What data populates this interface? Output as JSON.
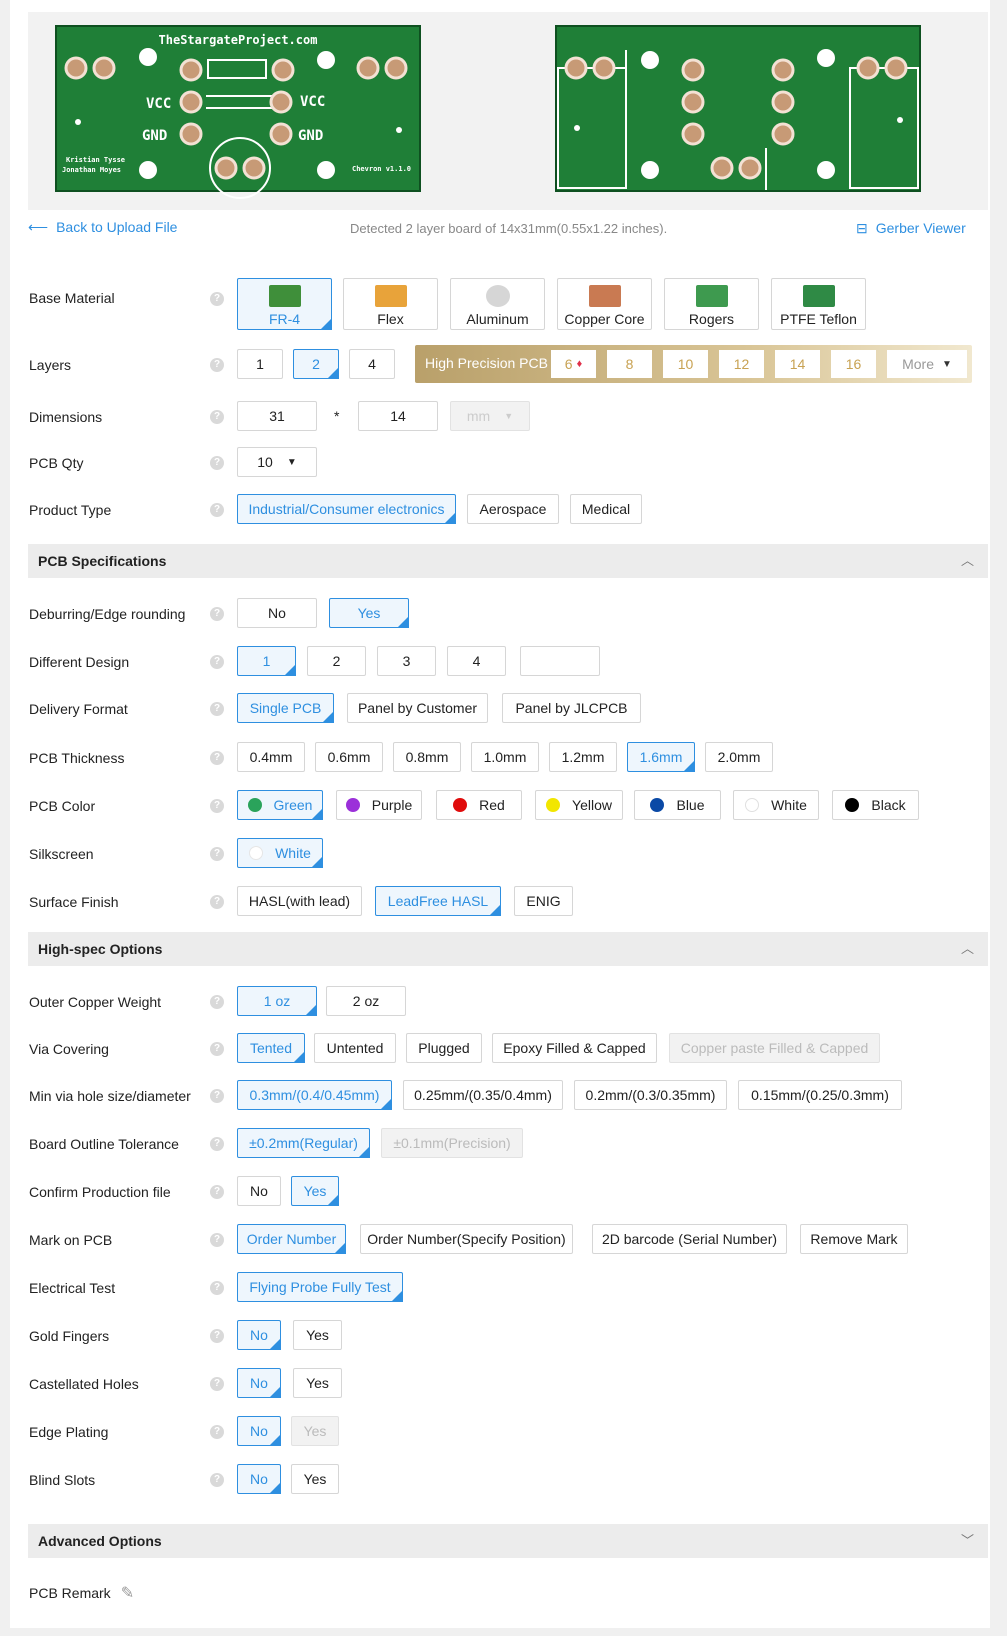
{
  "preview": {
    "top_text": "TheStargateProject.com",
    "vcc": "VCC",
    "gnd": "GND",
    "authors_line1": "Kristian Tysse",
    "authors_line2": "Jonathan Moyes",
    "version": "Chevron v1.1.0"
  },
  "nav": {
    "back": "Back to Upload File",
    "detected": "Detected 2 layer board of 14x31mm(0.55x1.22 inches).",
    "gerber": "Gerber Viewer"
  },
  "base_material": {
    "label": "Base Material",
    "options": [
      "FR-4",
      "Flex",
      "Aluminum",
      "Copper Core",
      "Rogers",
      "PTFE Teflon"
    ],
    "selected": "FR-4"
  },
  "layers": {
    "label": "Layers",
    "options": [
      "1",
      "2",
      "4"
    ],
    "selected": "2",
    "hp_label": "High Precision PCB",
    "hp_options": [
      "6",
      "8",
      "10",
      "12",
      "14",
      "16"
    ],
    "more": "More"
  },
  "dimensions": {
    "label": "Dimensions",
    "x": "31",
    "sep": "*",
    "y": "14",
    "unit": "mm"
  },
  "qty": {
    "label": "PCB Qty",
    "value": "10"
  },
  "product_type": {
    "label": "Product Type",
    "options": [
      "Industrial/Consumer electronics",
      "Aerospace",
      "Medical"
    ],
    "selected": "Industrial/Consumer electronics"
  },
  "pcb_spec": {
    "title": "PCB Specifications",
    "deburring": {
      "label": "Deburring/Edge rounding",
      "options": [
        "No",
        "Yes"
      ],
      "selected": "Yes"
    },
    "design": {
      "label": "Different Design",
      "options": [
        "1",
        "2",
        "3",
        "4",
        ""
      ],
      "selected": "1"
    },
    "delivery": {
      "label": "Delivery Format",
      "options": [
        "Single PCB",
        "Panel by Customer",
        "Panel by JLCPCB"
      ],
      "selected": "Single PCB"
    },
    "thickness": {
      "label": "PCB Thickness",
      "options": [
        "0.4mm",
        "0.6mm",
        "0.8mm",
        "1.0mm",
        "1.2mm",
        "1.6mm",
        "2.0mm"
      ],
      "selected": "1.6mm"
    },
    "color": {
      "label": "PCB Color",
      "options": [
        {
          "name": "Green",
          "hex": "#2aa35b"
        },
        {
          "name": "Purple",
          "hex": "#9b30d9"
        },
        {
          "name": "Red",
          "hex": "#e00c0c"
        },
        {
          "name": "Yellow",
          "hex": "#f2e600"
        },
        {
          "name": "Blue",
          "hex": "#0a49a6"
        },
        {
          "name": "White",
          "hex": "#ffffff"
        },
        {
          "name": "Black",
          "hex": "#000000"
        }
      ],
      "selected": "Green"
    },
    "silkscreen": {
      "label": "Silkscreen",
      "value": "White"
    },
    "surface": {
      "label": "Surface Finish",
      "options": [
        "HASL(with lead)",
        "LeadFree HASL",
        "ENIG"
      ],
      "selected": "LeadFree HASL"
    }
  },
  "high_spec": {
    "title": "High-spec Options",
    "copper": {
      "label": "Outer Copper Weight",
      "options": [
        "1 oz",
        "2 oz"
      ],
      "selected": "1 oz"
    },
    "via": {
      "label": "Via Covering",
      "options": [
        "Tented",
        "Untented",
        "Plugged",
        "Epoxy Filled & Capped",
        "Copper paste Filled & Capped"
      ],
      "selected": "Tented"
    },
    "minvia": {
      "label": "Min via hole size/diameter",
      "options": [
        "0.3mm/(0.4/0.45mm)",
        "0.25mm/(0.35/0.4mm)",
        "0.2mm/(0.3/0.35mm)",
        "0.15mm/(0.25/0.3mm)"
      ],
      "selected": "0.3mm/(0.4/0.45mm)"
    },
    "outline": {
      "label": "Board Outline Tolerance",
      "options": [
        "±0.2mm(Regular)",
        "±0.1mm(Precision)"
      ],
      "selected": "±0.2mm(Regular)"
    },
    "confirm": {
      "label": "Confirm Production file",
      "options": [
        "No",
        "Yes"
      ],
      "selected": "Yes"
    },
    "mark": {
      "label": "Mark on PCB",
      "options": [
        "Order Number",
        "Order Number(Specify Position)",
        "2D barcode (Serial Number)",
        "Remove Mark"
      ],
      "selected": "Order Number"
    },
    "etest": {
      "label": "Electrical Test",
      "value": "Flying Probe Fully Test"
    },
    "gold": {
      "label": "Gold Fingers",
      "options": [
        "No",
        "Yes"
      ],
      "selected": "No"
    },
    "castellated": {
      "label": "Castellated Holes",
      "options": [
        "No",
        "Yes"
      ],
      "selected": "No"
    },
    "edge": {
      "label": "Edge Plating",
      "options": [
        "No",
        "Yes"
      ],
      "selected": "No"
    },
    "blind": {
      "label": "Blind Slots",
      "options": [
        "No",
        "Yes"
      ],
      "selected": "No"
    }
  },
  "advanced": {
    "title": "Advanced Options"
  },
  "remark": {
    "label": "PCB Remark"
  }
}
